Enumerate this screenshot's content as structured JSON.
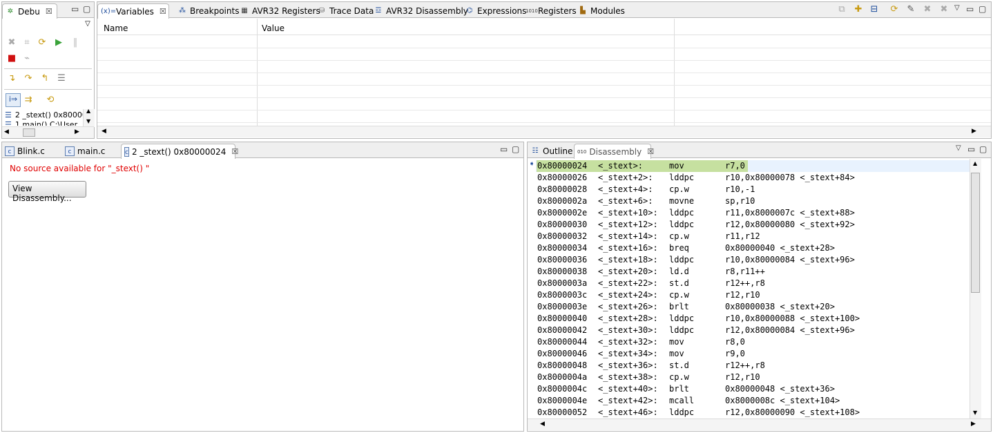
{
  "debug": {
    "title": "Debu",
    "stack": [
      {
        "label": "2 _stext()  0x80000"
      },
      {
        "label": "1 main() C:\\User"
      }
    ]
  },
  "variables": {
    "tabs": [
      "Variables",
      "Breakpoints",
      "AVR32 Registers",
      "Trace Data",
      "AVR32 Disassembly",
      "Expressions",
      "Registers",
      "Modules"
    ],
    "columns": [
      "Name",
      "Value"
    ]
  },
  "editor": {
    "tabs": [
      "Blink.c",
      "main.c",
      "2 _stext()  0x80000024"
    ],
    "message": "No source available for \"_stext() \"",
    "button_label": "View Disassembly..."
  },
  "right": {
    "tabs": [
      "Outline",
      "Disassembly"
    ],
    "rows": [
      {
        "addr": "0x80000024",
        "sym": "<_stext>:",
        "op": "mov",
        "args": "r7,0"
      },
      {
        "addr": "0x80000026",
        "sym": "<_stext+2>:",
        "op": "lddpc",
        "args": "r10,0x80000078 <_stext+84>"
      },
      {
        "addr": "0x80000028",
        "sym": "<_stext+4>:",
        "op": "cp.w",
        "args": "r10,-1"
      },
      {
        "addr": "0x8000002a",
        "sym": "<_stext+6>:",
        "op": "movne",
        "args": "sp,r10"
      },
      {
        "addr": "0x8000002e",
        "sym": "<_stext+10>:",
        "op": "lddpc",
        "args": "r11,0x8000007c <_stext+88>"
      },
      {
        "addr": "0x80000030",
        "sym": "<_stext+12>:",
        "op": "lddpc",
        "args": "r12,0x80000080 <_stext+92>"
      },
      {
        "addr": "0x80000032",
        "sym": "<_stext+14>:",
        "op": "cp.w",
        "args": "r11,r12"
      },
      {
        "addr": "0x80000034",
        "sym": "<_stext+16>:",
        "op": "breq",
        "args": "0x80000040 <_stext+28>"
      },
      {
        "addr": "0x80000036",
        "sym": "<_stext+18>:",
        "op": "lddpc",
        "args": "r10,0x80000084 <_stext+96>"
      },
      {
        "addr": "0x80000038",
        "sym": "<_stext+20>:",
        "op": "ld.d",
        "args": "r8,r11++"
      },
      {
        "addr": "0x8000003a",
        "sym": "<_stext+22>:",
        "op": "st.d",
        "args": "r12++,r8"
      },
      {
        "addr": "0x8000003c",
        "sym": "<_stext+24>:",
        "op": "cp.w",
        "args": "r12,r10"
      },
      {
        "addr": "0x8000003e",
        "sym": "<_stext+26>:",
        "op": "brlt",
        "args": "0x80000038 <_stext+20>"
      },
      {
        "addr": "0x80000040",
        "sym": "<_stext+28>:",
        "op": "lddpc",
        "args": "r10,0x80000088 <_stext+100>"
      },
      {
        "addr": "0x80000042",
        "sym": "<_stext+30>:",
        "op": "lddpc",
        "args": "r12,0x80000084 <_stext+96>"
      },
      {
        "addr": "0x80000044",
        "sym": "<_stext+32>:",
        "op": "mov",
        "args": "r8,0"
      },
      {
        "addr": "0x80000046",
        "sym": "<_stext+34>:",
        "op": "mov",
        "args": "r9,0"
      },
      {
        "addr": "0x80000048",
        "sym": "<_stext+36>:",
        "op": "st.d",
        "args": "r12++,r8"
      },
      {
        "addr": "0x8000004a",
        "sym": "<_stext+38>:",
        "op": "cp.w",
        "args": "r12,r10"
      },
      {
        "addr": "0x8000004c",
        "sym": "<_stext+40>:",
        "op": "brlt",
        "args": "0x80000048 <_stext+36>"
      },
      {
        "addr": "0x8000004e",
        "sym": "<_stext+42>:",
        "op": "mcall",
        "args": "0x8000008c <_stext+104>"
      },
      {
        "addr": "0x80000052",
        "sym": "<_stext+46>:",
        "op": "lddpc",
        "args": "r12,0x80000090 <_stext+108>"
      }
    ]
  },
  "colors": {
    "highlight": "#c6e0a0",
    "current": "#e8f2fe",
    "error": "#e00000"
  }
}
